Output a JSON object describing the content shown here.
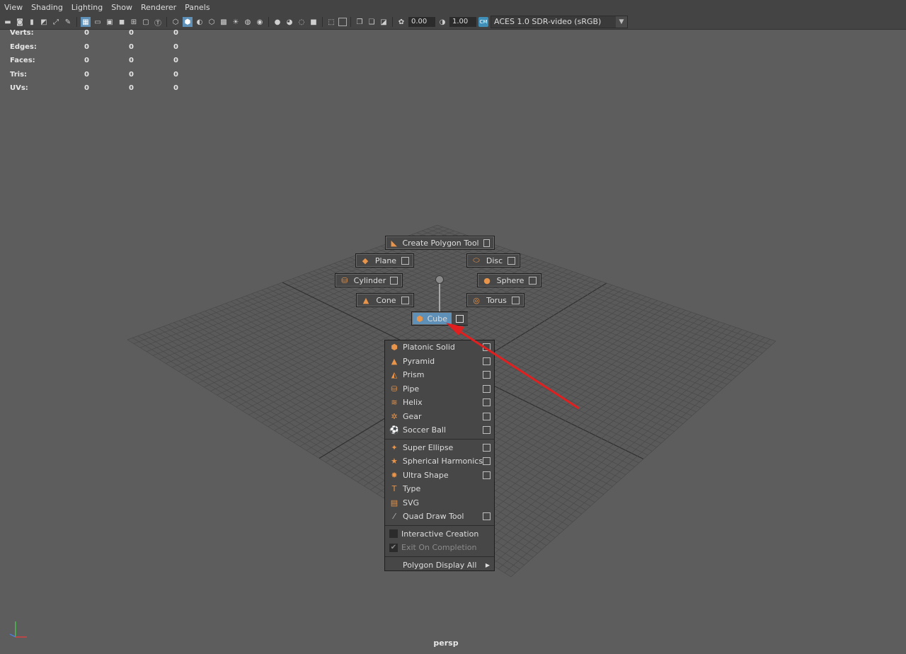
{
  "menubar": {
    "items": [
      "View",
      "Shading",
      "Lighting",
      "Show",
      "Renderer",
      "Panels"
    ]
  },
  "toolbar": {
    "exposure": "0.00",
    "gamma": "1.00",
    "color_space": "ACES 1.0 SDR-video (sRGB)",
    "colors": {
      "active": "#5e90b8",
      "accent": "#e8944a"
    }
  },
  "hud": {
    "rows": [
      {
        "label": "Verts:",
        "v1": "0",
        "v2": "0",
        "v3": "0"
      },
      {
        "label": "Edges:",
        "v1": "0",
        "v2": "0",
        "v3": "0"
      },
      {
        "label": "Faces:",
        "v1": "0",
        "v2": "0",
        "v3": "0"
      },
      {
        "label": "Tris:",
        "v1": "0",
        "v2": "0",
        "v3": "0"
      },
      {
        "label": "UVs:",
        "v1": "0",
        "v2": "0",
        "v3": "0"
      }
    ]
  },
  "marking_menu": {
    "north": "Create Polygon Tool",
    "north_west": "Plane",
    "north_east": "Disc",
    "west": "Cylinder",
    "east": "Sphere",
    "south_west": "Cone",
    "south_east": "Torus",
    "south": "Cube"
  },
  "submenu": {
    "items": [
      {
        "label": "Platonic Solid",
        "icon": "platonic-icon"
      },
      {
        "label": "Pyramid",
        "icon": "pyramid-icon"
      },
      {
        "label": "Prism",
        "icon": "prism-icon"
      },
      {
        "label": "Pipe",
        "icon": "pipe-icon"
      },
      {
        "label": "Helix",
        "icon": "helix-icon"
      },
      {
        "label": "Gear",
        "icon": "gear-icon"
      },
      {
        "label": "Soccer Ball",
        "icon": "soccer-ball-icon"
      },
      {
        "label": "Super Ellipse",
        "icon": "super-ellipse-icon"
      },
      {
        "label": "Spherical Harmonics",
        "icon": "spherical-harmonics-icon"
      },
      {
        "label": "Ultra Shape",
        "icon": "ultra-shape-icon"
      },
      {
        "label": "Type",
        "icon": "type-icon"
      },
      {
        "label": "SVG",
        "icon": "svg-icon"
      },
      {
        "label": "Quad Draw Tool",
        "icon": "quad-draw-icon"
      },
      {
        "label": "Interactive Creation"
      },
      {
        "label": "Exit On Completion"
      },
      {
        "label": "Polygon Display All"
      }
    ]
  },
  "viewport": {
    "camera": "persp",
    "annotation_color": "#e02020"
  }
}
